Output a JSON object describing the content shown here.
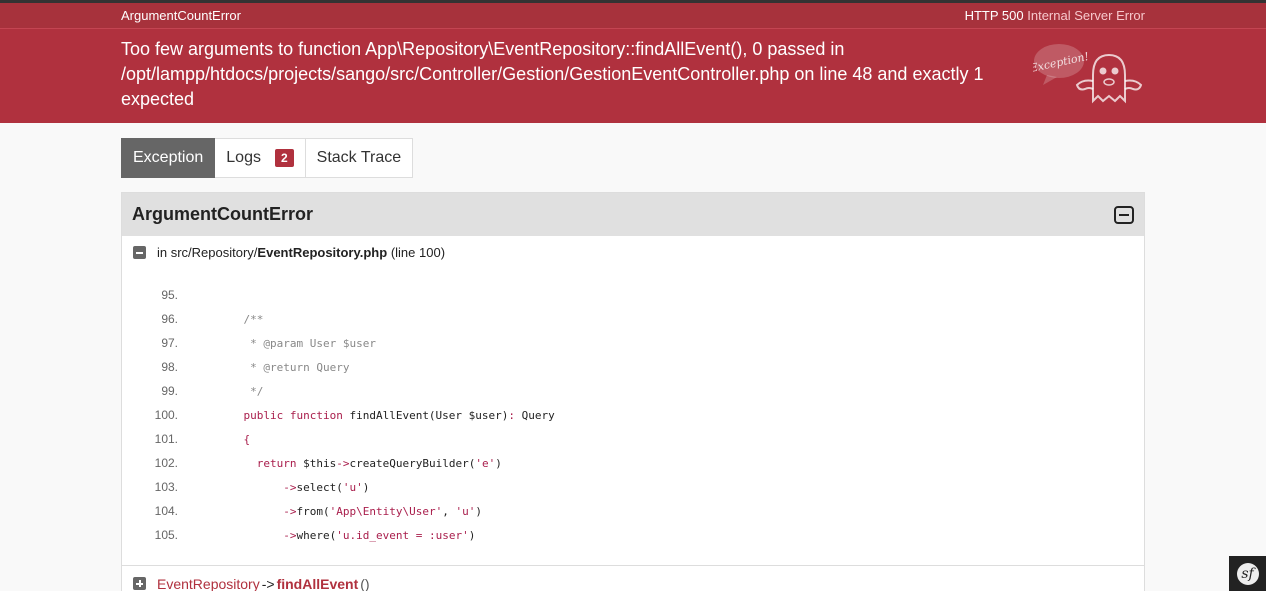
{
  "meta": {
    "exception_class": "ArgumentCountError",
    "status_code": "HTTP 500",
    "status_text": "Internal Server Error"
  },
  "header": {
    "message": "Too few arguments to function App\\Repository\\EventRepository::findAllEvent(), 0 passed in /opt/lampp/htdocs/projects/sango/src/Controller/Gestion/GestionEventController.php on line 48 and exactly 1 expected",
    "ghost_bubble_text": "Exception!"
  },
  "tabs": [
    {
      "label": "Exception"
    },
    {
      "label": "Logs",
      "badge": "2"
    },
    {
      "label": "Stack Trace"
    }
  ],
  "panel": {
    "title": "ArgumentCountError",
    "trace": {
      "prefix": "in src/Repository/",
      "file": "EventRepository.php",
      "line": "(line 100)"
    },
    "code_lines": [
      {
        "n": "95.",
        "html": ""
      },
      {
        "n": "96.",
        "html": "    <span class='c'>/**</span>"
      },
      {
        "n": "97.",
        "html": "     <span class='c'>* @param User $user</span>"
      },
      {
        "n": "98.",
        "html": "     <span class='c'>* @return Query</span>"
      },
      {
        "n": "99.",
        "html": "     <span class='c'>*/</span>"
      },
      {
        "n": "100.",
        "html": "    <span class='k'>public function</span> findAllEvent(User $user)<span class='k'>:</span> Query"
      },
      {
        "n": "101.",
        "html": "    <span class='k'>{</span>"
      },
      {
        "n": "102.",
        "html": "      <span class='k'>return</span> $this<span class='k'>-></span>createQueryBuilder(<span class='k'>'e'</span>)"
      },
      {
        "n": "103.",
        "html": "          <span class='k'>-></span>select(<span class='k'>'u'</span>)"
      },
      {
        "n": "104.",
        "html": "          <span class='k'>-></span>from(<span class='k'>'App\\Entity\\User'</span>, <span class='k'>'u'</span>)"
      },
      {
        "n": "105.",
        "html": "          <span class='k'>-></span>where(<span class='k'>'u.id_event = :user'</span>)"
      }
    ],
    "next_trace": {
      "class": "EventRepository",
      "arrow": "->",
      "function": "findAllEvent",
      "args": "()"
    }
  },
  "colors": {
    "header_bg": "#b0313e",
    "meta_bg": "#a7323c",
    "tab_active_bg": "#666666",
    "keyword": "#a91e4c"
  }
}
